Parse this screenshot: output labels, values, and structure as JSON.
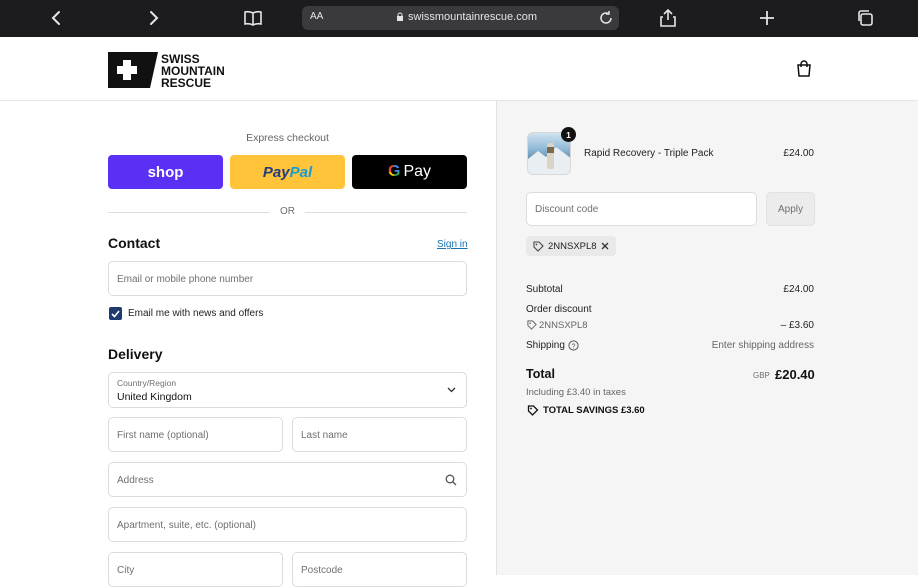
{
  "browser": {
    "text_size_label": "AA",
    "url": "swissmountainrescue.com"
  },
  "header": {
    "logo_lines": [
      "SWISS",
      "MOUNTAIN",
      "RESCUE"
    ]
  },
  "checkout": {
    "express_label": "Express checkout",
    "shop_label": "shop",
    "paypal_label_1": "Pay",
    "paypal_label_2": "Pal",
    "gpay_g": "G",
    "gpay_label": "Pay",
    "or_label": "OR",
    "contact_title": "Contact",
    "signin_label": "Sign in",
    "email_placeholder": "Email or mobile phone number",
    "newsletter_label": "Email me with news and offers",
    "newsletter_checked": true,
    "delivery_title": "Delivery",
    "country_label": "Country/Region",
    "country_value": "United Kingdom",
    "first_name_placeholder": "First name (optional)",
    "last_name_placeholder": "Last name",
    "address_placeholder": "Address",
    "apartment_placeholder": "Apartment, suite, etc. (optional)",
    "city_placeholder": "City",
    "postcode_placeholder": "Postcode"
  },
  "summary": {
    "product": {
      "quantity": "1",
      "name": "Rapid Recovery - Triple Pack",
      "price": "£24.00"
    },
    "discount_placeholder": "Discount code",
    "apply_label": "Apply",
    "applied_code": "2NNSXPL8",
    "subtotal_label": "Subtotal",
    "subtotal_value": "£24.00",
    "order_discount_label": "Order discount",
    "order_discount_code": "2NNSXPL8",
    "order_discount_value": "– £3.60",
    "shipping_label": "Shipping",
    "shipping_value": "Enter shipping address",
    "total_label": "Total",
    "currency": "GBP",
    "total_value": "£20.40",
    "taxes_note": "Including £3.40 in taxes",
    "total_savings": "TOTAL SAVINGS  £3.60"
  },
  "colors": {
    "shop_purple": "#5a31f4",
    "paypal_yellow": "#ffc439",
    "gpay_black": "#000000",
    "link_blue": "#1773b0",
    "checkbox_navy": "#1f3a6e"
  }
}
